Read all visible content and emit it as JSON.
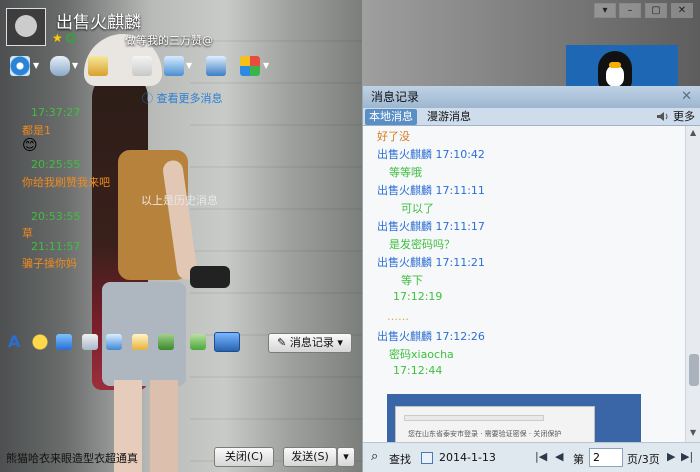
{
  "window": {
    "nickname": "出售火麒麟",
    "signature": "做等我的三万赞@",
    "controls": [
      "▾",
      "–",
      "▢",
      "✕"
    ]
  },
  "colors": {
    "time_green": "#3fbf3f",
    "msg_orange": "#f08a1e",
    "name_blue": "#2d6fd6"
  },
  "chat": {
    "more_link": "查看更多消息",
    "history_label": "以上是历史消息",
    "lines": [
      {
        "text": "17:37:27",
        "kind": "time"
      },
      {
        "text": "都是1",
        "kind": "msg"
      },
      {
        "text": "😊",
        "kind": "emoji"
      },
      {
        "text": "20:25:55",
        "kind": "time"
      },
      {
        "text": "你给我刷赞我来吧",
        "kind": "msg"
      },
      {
        "text": "20:53:55",
        "kind": "time"
      },
      {
        "text": "草",
        "kind": "msg"
      },
      {
        "text": "21:11:57",
        "kind": "time"
      },
      {
        "text": "骗子操你妈",
        "kind": "msg"
      }
    ]
  },
  "toolbar_bottom": {
    "history_button": "消息记录"
  },
  "input": {
    "text": "熊猫哈衣来眼造型衣超通真"
  },
  "buttons": {
    "close": "关闭(C)",
    "send": "发送(S)"
  },
  "log": {
    "title": "消息记录",
    "tabs": [
      "本地消息",
      "漫游消息"
    ],
    "more": "更多",
    "records": [
      {
        "text": "好了没",
        "kind": "msg-o"
      },
      {
        "text": "出售火麒麟 17:10:42",
        "kind": "who"
      },
      {
        "text": "等等哦",
        "kind": "msg"
      },
      {
        "text": "出售火麒麟 17:11:11",
        "kind": "who"
      },
      {
        "text": "可以了",
        "kind": "msg"
      },
      {
        "text": "出售火麒麟 17:11:17",
        "kind": "who"
      },
      {
        "text": "是发密码吗？",
        "kind": "msg"
      },
      {
        "text": "出售火麒麟 17:11:21",
        "kind": "who"
      },
      {
        "text": "等下",
        "kind": "msg"
      },
      {
        "text": "17:12:19",
        "kind": "tstamp"
      },
      {
        "text": "……",
        "kind": "dots"
      },
      {
        "text": "出售火麒麟 17:12:26",
        "kind": "who"
      },
      {
        "text": "密码xiaocha",
        "kind": "msg"
      },
      {
        "text": "17:12:44",
        "kind": "tstamp"
      }
    ],
    "screenshot_caption": "您在山东省泰安市登录 · 需要验证密保 · 关闭保护",
    "footer": {
      "search": "查找",
      "date": "2014-1-13",
      "page_prefix": "第",
      "page_value": "2",
      "page_suffix": "页/3页"
    }
  }
}
